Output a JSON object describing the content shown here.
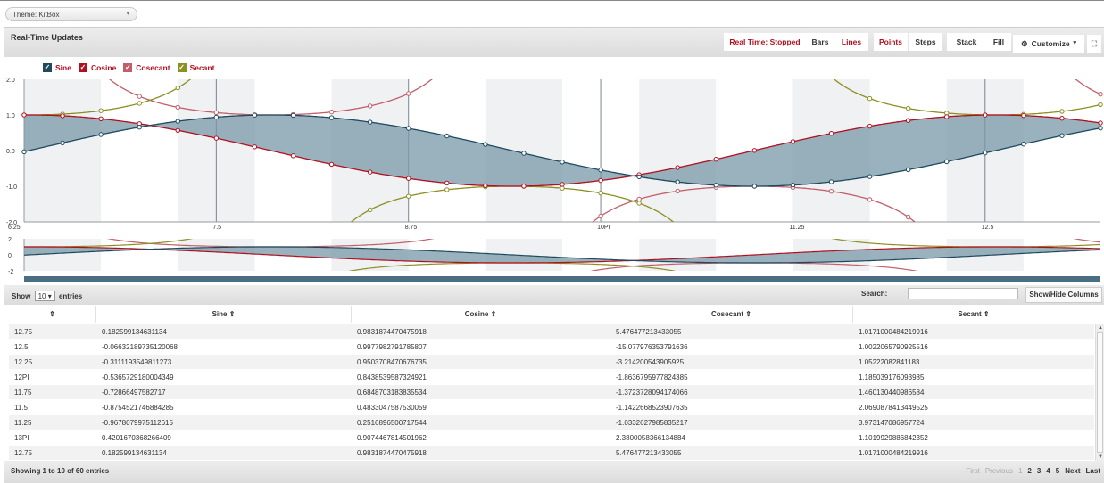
{
  "theme": {
    "label": "Theme: KitBox"
  },
  "panel": {
    "title": "Real-Time Updates",
    "buttons": [
      "Real Time: Stopped",
      "Bars",
      "Lines",
      "Points",
      "Steps",
      "Stack",
      "Fill"
    ],
    "customize": "Customize",
    "colors": {
      "sine": "#1f4a5e",
      "cosine": "#b01020",
      "cosecant": "#c15e6a",
      "secant": "#8c9022",
      "fill": "#7898a8"
    }
  },
  "legend": [
    "Sine",
    "Cosine",
    "Cosecant",
    "Secant"
  ],
  "icons": {
    "customize": "gear-icon",
    "expand": "expand-icon",
    "checkbox": "checkmark-icon"
  },
  "chart_data": {
    "type": "line",
    "x_ticks": [
      "6.25",
      "7.5",
      "8.75",
      "10PI",
      "11.25",
      "12.5"
    ],
    "x_tick_values": [
      6.25,
      7.5,
      8.75,
      10,
      11.25,
      12.5
    ],
    "y_ticks": [
      "2.0",
      "1.0",
      "0.0",
      "-1.0",
      "-2.0"
    ],
    "y_tick_values": [
      2,
      1,
      0,
      -1,
      -2
    ],
    "xlim": [
      6.25,
      13.25
    ],
    "ylim": [
      -2,
      2
    ],
    "series": [
      {
        "name": "Sine",
        "func": "sin",
        "color": "#1f4a5e"
      },
      {
        "name": "Cosine",
        "func": "cos",
        "color": "#b01020"
      },
      {
        "name": "Cosecant",
        "func": "csc",
        "color": "#c15e6a"
      },
      {
        "name": "Secant",
        "func": "sec",
        "color": "#8c9022"
      }
    ],
    "fill_between": [
      "Sine",
      "Cosine"
    ],
    "navigator": {
      "y_ticks": [
        "2",
        "0",
        "-2"
      ],
      "y_tick_values": [
        2,
        0,
        -2
      ]
    }
  },
  "controls": {
    "show_label": "Show",
    "entries_value": "10",
    "entries_label": "entries",
    "search_label": "Search:",
    "search_value": "",
    "show_hide": "Show/Hide Columns"
  },
  "table": {
    "headers": [
      "",
      "Sine",
      "Cosine",
      "Cosecant",
      "Secant"
    ],
    "rows": [
      [
        "12.75",
        "0.182599134631134",
        "0.9831874470475918",
        "5.476477213433055",
        "1.0171000484219916"
      ],
      [
        "12.5",
        "-0.06632189735120068",
        "0.9977982791785807",
        "-15.077976353791636",
        "1.0022065790925516"
      ],
      [
        "12.25",
        "-0.3111193549811273",
        "0.9503708470676735",
        "-3.214200543905925",
        "1.05222082841183"
      ],
      [
        "12PI",
        "-0.5365729180004349",
        "0.8438539587324921",
        "-1.8636795977824385",
        "1.185039176093985"
      ],
      [
        "11.75",
        "-0.72866497582717",
        "0.6848703183835534",
        "-1.3723728094174066",
        "1.460130440986584"
      ],
      [
        "11.5",
        "-0.8754521746884285",
        "0.4833047587530059",
        "-1.1422668523907635",
        "2.0690878413449525"
      ],
      [
        "11.25",
        "-0.9678079975112615",
        "0.2516896500717544",
        "-1.0332627985835217",
        "3.973147086957724"
      ],
      [
        "13PI",
        "0.4201670368266409",
        "0.9074467814501962",
        "2.3800058366134884",
        "1.1019929886842352"
      ],
      [
        "12.75",
        "0.182599134631134",
        "0.9831874470475918",
        "5.476477213433055",
        "1.0171000484219916"
      ],
      [
        "12.5",
        "-0.06632189735120068",
        "0.9977982791785807",
        "-15.077976353791636",
        "1.0022065790925516"
      ]
    ]
  },
  "footer": {
    "info": "Showing 1 to 10 of 60 entries",
    "pager": [
      "First",
      "Previous",
      "1",
      "2",
      "3",
      "4",
      "5",
      "Next",
      "Last"
    ]
  }
}
